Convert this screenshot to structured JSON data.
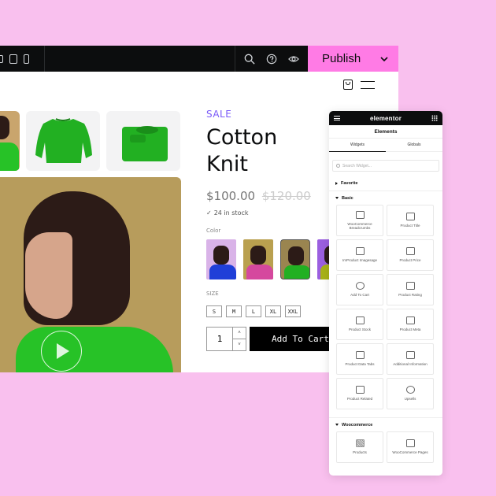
{
  "topbar": {
    "device_icons": [
      "desktop-icon",
      "tablet-icon",
      "mobile-icon"
    ],
    "tool_icons": [
      "search-icon",
      "help-icon",
      "preview-eye-icon"
    ],
    "publish_label": "Publish",
    "colors": {
      "bar": "#0c0d0e",
      "publish": "#ff7be5"
    }
  },
  "product": {
    "badge": "SALE",
    "title_line1": "Cotton",
    "title_line2": "Knit",
    "price": "$100.00",
    "old_price": "$120.00",
    "stock": "24 in stock",
    "color_label": "Color",
    "color_options": [
      {
        "name": "blue",
        "bg": "#d9b3e8",
        "sweater": "#1f3fd8"
      },
      {
        "name": "pink",
        "bg": "#b9a04f",
        "sweater": "#d5489e"
      },
      {
        "name": "green",
        "bg": "#9a8550",
        "sweater": "#22b022",
        "selected": true
      },
      {
        "name": "olive",
        "bg": "#9b5fe0",
        "sweater": "#a8b217"
      }
    ],
    "size_label": "SIZE",
    "sizes": [
      "S",
      "M",
      "L",
      "XL",
      "XXL"
    ],
    "quantity": "1",
    "add_to_cart_label": "Add To Cart"
  },
  "panel": {
    "brand": "elementor",
    "title": "Elements",
    "tabs": [
      "Widgets",
      "Globals"
    ],
    "search_placeholder": "Search Widget...",
    "sections": {
      "favorite": "Favorite",
      "basic": "Basic",
      "woocommerce": "Woocommerce"
    },
    "basic_widgets": [
      "WooCommerce Breadcrumbs",
      "Product Title",
      "ImProduct Imagesage",
      "Product Price",
      "Add To Cart",
      "Product Rating",
      "Product Stock",
      "Product Meta",
      "Product Data Tabs",
      "Additional Information",
      "Product Related",
      "Upsells"
    ],
    "woo_widgets": [
      "Products",
      "WooCommerce Pages"
    ]
  }
}
